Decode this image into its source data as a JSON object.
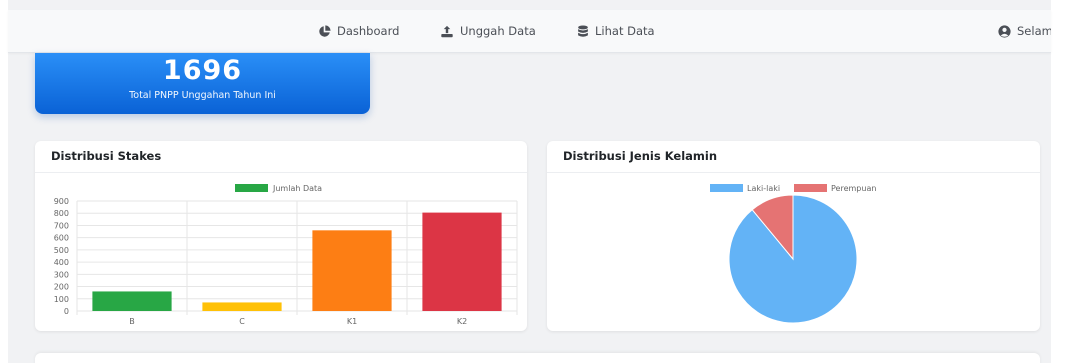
{
  "nav": {
    "items": [
      {
        "label": "Dashboard",
        "icon": "pie-chart-icon"
      },
      {
        "label": "Unggah Data",
        "icon": "upload-icon"
      },
      {
        "label": "Lihat Data",
        "icon": "database-icon"
      }
    ],
    "user_label": "Selamat",
    "user_icon": "user-circle-icon"
  },
  "summary": {
    "value": "1696",
    "label": "Total PNPP Unggahan Tahun Ini"
  },
  "stakes_card": {
    "title": "Distribusi Stakes"
  },
  "gender_card": {
    "title": "Distribusi Jenis Kelamin"
  },
  "colors": {
    "accent": "#1a77ec",
    "bar_green": "#28a745",
    "bar_yellow": "#ffc107",
    "bar_orange": "#fd7e14",
    "bar_red": "#dc3545",
    "pie_blue": "#63b3f6",
    "pie_red": "#e57373"
  },
  "chart_data": [
    {
      "type": "bar",
      "title": "Distribusi Stakes",
      "categories": [
        "B",
        "C",
        "K1",
        "K2"
      ],
      "series": [
        {
          "name": "Jumlah Data",
          "values": [
            160,
            70,
            660,
            805
          ]
        }
      ],
      "bar_colors": [
        "#28a745",
        "#ffc107",
        "#fd7e14",
        "#dc3545"
      ],
      "ylim": [
        0,
        900
      ],
      "yticks": [
        0,
        100,
        200,
        300,
        400,
        500,
        600,
        700,
        800,
        900
      ],
      "grid": true,
      "legend": "top"
    },
    {
      "type": "pie",
      "title": "Distribusi Jenis Kelamin",
      "labels": [
        "Laki-laki",
        "Perempuan"
      ],
      "values": [
        89,
        11
      ],
      "colors": [
        "#63b3f6",
        "#e57373"
      ],
      "legend": "top"
    }
  ]
}
